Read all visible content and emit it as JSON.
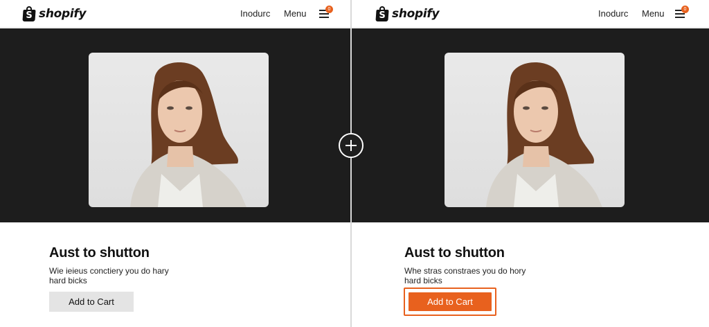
{
  "brand": {
    "name": "shopify",
    "logo_icon": "shopify-bag-icon",
    "logo_letter": "S"
  },
  "nav": {
    "link_label": "Inodurc",
    "menu_label": "Menu",
    "cart_badge": "0"
  },
  "colors": {
    "accent": "#e8611e",
    "hero_bg": "#1d1d1d",
    "button_grey": "#e4e4e4"
  },
  "variant_a": {
    "title": "Aust to shutton",
    "description": "Wie ieieus conctiery you do hary hard bicks",
    "button_label": "Add to Cart"
  },
  "variant_b": {
    "title": "Aust to shutton",
    "description": "Whe stras constraes you do hory hard bicks",
    "button_label": "Add to Cart"
  },
  "divider": {
    "icon": "plus-icon"
  }
}
